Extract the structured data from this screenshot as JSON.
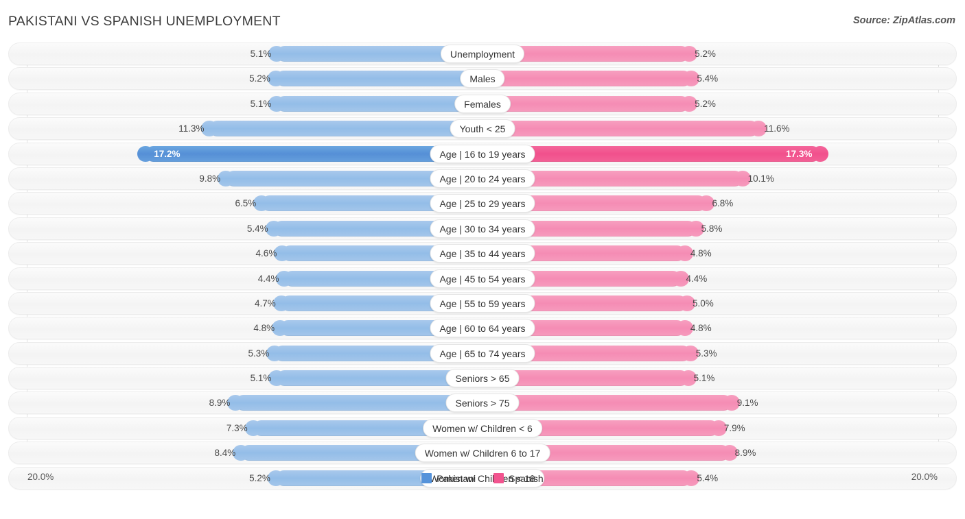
{
  "header": {
    "title": "PAKISTANI VS SPANISH UNEMPLOYMENT",
    "source": "Source: ZipAtlas.com"
  },
  "axis": {
    "left_label": "20.0%",
    "right_label": "20.0%",
    "max": 20.0
  },
  "legend": [
    {
      "label": "Pakistani",
      "color": "#5693da"
    },
    {
      "label": "Spanish",
      "color": "#f2548f"
    }
  ],
  "colors": {
    "pakistani": "#93bde8",
    "spanish": "#f58cb4",
    "pakistani_highlight": "#558fd6",
    "spanish_highlight": "#f1508c",
    "track": "#f4f4f4"
  },
  "chart_data": {
    "type": "bar",
    "title": "PAKISTANI VS SPANISH UNEMPLOYMENT",
    "subtitle": "Source: ZipAtlas.com",
    "orientation": "horizontal-diverging",
    "xlabel": "",
    "ylabel": "",
    "xlim": [
      20.0,
      20.0
    ],
    "grid": true,
    "legend_position": "bottom-center",
    "categories": [
      "Unemployment",
      "Males",
      "Females",
      "Youth < 25",
      "Age | 16 to 19 years",
      "Age | 20 to 24 years",
      "Age | 25 to 29 years",
      "Age | 30 to 34 years",
      "Age | 35 to 44 years",
      "Age | 45 to 54 years",
      "Age | 55 to 59 years",
      "Age | 60 to 64 years",
      "Age | 65 to 74 years",
      "Seniors > 65",
      "Seniors > 75",
      "Women w/ Children < 6",
      "Women w/ Children 6 to 17",
      "Women w/ Children < 18"
    ],
    "series": [
      {
        "name": "Pakistani",
        "color": "#93bde8",
        "values": [
          5.1,
          5.2,
          5.1,
          11.3,
          17.2,
          9.8,
          6.5,
          5.4,
          4.6,
          4.4,
          4.7,
          4.8,
          5.3,
          5.1,
          8.9,
          7.3,
          8.4,
          5.2
        ]
      },
      {
        "name": "Spanish",
        "color": "#f58cb4",
        "values": [
          5.2,
          5.4,
          5.2,
          11.6,
          17.3,
          10.1,
          6.8,
          5.8,
          4.8,
          4.4,
          5.0,
          4.8,
          5.3,
          5.1,
          9.1,
          7.9,
          8.9,
          5.4
        ]
      }
    ]
  },
  "rows": [
    {
      "label": "Unemployment",
      "left": "5.1%",
      "right": "5.2%",
      "lv": 5.1,
      "rv": 5.2,
      "highlight": false
    },
    {
      "label": "Males",
      "left": "5.2%",
      "right": "5.4%",
      "lv": 5.2,
      "rv": 5.4,
      "highlight": false
    },
    {
      "label": "Females",
      "left": "5.1%",
      "right": "5.2%",
      "lv": 5.1,
      "rv": 5.2,
      "highlight": false
    },
    {
      "label": "Youth < 25",
      "left": "11.3%",
      "right": "11.6%",
      "lv": 11.3,
      "rv": 11.6,
      "highlight": false
    },
    {
      "label": "Age | 16 to 19 years",
      "left": "17.2%",
      "right": "17.3%",
      "lv": 17.2,
      "rv": 17.3,
      "highlight": true
    },
    {
      "label": "Age | 20 to 24 years",
      "left": "9.8%",
      "right": "10.1%",
      "lv": 9.8,
      "rv": 10.1,
      "highlight": false
    },
    {
      "label": "Age | 25 to 29 years",
      "left": "6.5%",
      "right": "6.8%",
      "lv": 6.5,
      "rv": 6.8,
      "highlight": false
    },
    {
      "label": "Age | 30 to 34 years",
      "left": "5.4%",
      "right": "5.8%",
      "lv": 5.4,
      "rv": 5.8,
      "highlight": false
    },
    {
      "label": "Age | 35 to 44 years",
      "left": "4.6%",
      "right": "4.8%",
      "lv": 4.6,
      "rv": 4.8,
      "highlight": false
    },
    {
      "label": "Age | 45 to 54 years",
      "left": "4.4%",
      "right": "4.4%",
      "lv": 4.4,
      "rv": 4.4,
      "highlight": false
    },
    {
      "label": "Age | 55 to 59 years",
      "left": "4.7%",
      "right": "5.0%",
      "lv": 4.7,
      "rv": 5.0,
      "highlight": false
    },
    {
      "label": "Age | 60 to 64 years",
      "left": "4.8%",
      "right": "4.8%",
      "lv": 4.8,
      "rv": 4.8,
      "highlight": false
    },
    {
      "label": "Age | 65 to 74 years",
      "left": "5.3%",
      "right": "5.3%",
      "lv": 5.3,
      "rv": 5.3,
      "highlight": false
    },
    {
      "label": "Seniors > 65",
      "left": "5.1%",
      "right": "5.1%",
      "lv": 5.1,
      "rv": 5.1,
      "highlight": false
    },
    {
      "label": "Seniors > 75",
      "left": "8.9%",
      "right": "9.1%",
      "lv": 8.9,
      "rv": 9.1,
      "highlight": false
    },
    {
      "label": "Women w/ Children < 6",
      "left": "7.3%",
      "right": "7.9%",
      "lv": 7.3,
      "rv": 7.9,
      "highlight": false
    },
    {
      "label": "Women w/ Children 6 to 17",
      "left": "8.4%",
      "right": "8.9%",
      "lv": 8.4,
      "rv": 8.9,
      "highlight": false
    },
    {
      "label": "Women w/ Children < 18",
      "left": "5.2%",
      "right": "5.4%",
      "lv": 5.2,
      "rv": 5.4,
      "highlight": false
    }
  ]
}
